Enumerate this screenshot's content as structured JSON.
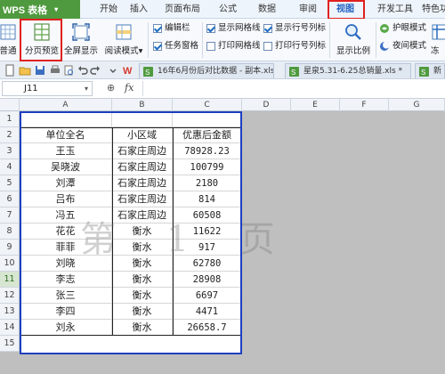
{
  "app": {
    "name": "WPS 表格"
  },
  "menu": {
    "tabs": [
      "开始",
      "插入",
      "页面布局",
      "公式",
      "数据",
      "审阅",
      "视图",
      "开发工具",
      "特色功"
    ],
    "active": "视图"
  },
  "ribbon": {
    "normal_label": "普通",
    "page_break_preview_label": "分页预览",
    "full_screen_label": "全屏显示",
    "reading_mode_label": "阅读模式",
    "reading_mode_arrow": "▾",
    "formula_bar_label": "编辑栏",
    "task_pane_label": "任务窗格",
    "show_gridlines_label": "显示网格线",
    "print_gridlines_label": "打印网格线",
    "show_row_col_label": "显示行号列标",
    "print_row_col_label": "打印行号列标",
    "show_ratio_label": "显示比例",
    "eye_mode_label": "护眼模式",
    "night_mode_label": "夜间模式",
    "freeze_label": "冻"
  },
  "doc_tabs": [
    {
      "label": "16年6月份后对比数据 - 副本.xls"
    },
    {
      "label": "星泉5.31-6.25总销量.xls *"
    },
    {
      "label": "新"
    }
  ],
  "formula_bar": {
    "cell_ref": "J11",
    "fx_label": "fx",
    "content": ""
  },
  "columns": [
    "A",
    "B",
    "C",
    "D",
    "E",
    "F",
    "G"
  ],
  "rows": [
    "1",
    "2",
    "3",
    "4",
    "5",
    "6",
    "7",
    "8",
    "9",
    "10",
    "11",
    "12",
    "13",
    "14",
    "15"
  ],
  "selected_row": "11",
  "table": {
    "headers": [
      "单位全名",
      "小区域",
      "优惠后金额"
    ],
    "rows": [
      [
        "王玉",
        "石家庄周边",
        "78928.23"
      ],
      [
        "吴晓波",
        "石家庄周边",
        "100799"
      ],
      [
        "刘潭",
        "石家庄周边",
        "2180"
      ],
      [
        "吕布",
        "石家庄周边",
        "814"
      ],
      [
        "冯五",
        "石家庄周边",
        "60508"
      ],
      [
        "花花",
        "衡水",
        "11622"
      ],
      [
        "菲菲",
        "衡水",
        "917"
      ],
      [
        "刘晓",
        "衡水",
        "62780"
      ],
      [
        "李志",
        "衡水",
        "28908"
      ],
      [
        "张三",
        "衡水",
        "6697"
      ],
      [
        "李四",
        "衡水",
        "4471"
      ],
      [
        "刘永",
        "衡水",
        "26658.7"
      ]
    ]
  },
  "watermark": "第 1 页",
  "colors": {
    "accent_red": "#e02020",
    "page_border": "#1e3fbf",
    "app_green": "#4f9a3e"
  }
}
